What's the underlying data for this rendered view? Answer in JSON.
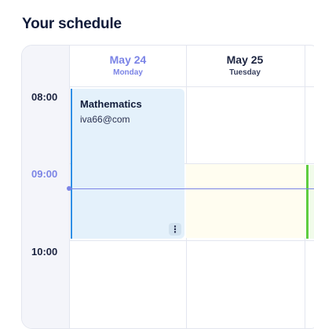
{
  "page": {
    "title": "Your schedule"
  },
  "calendar": {
    "days": [
      {
        "date": "May 24",
        "weekday": "Monday",
        "active": true
      },
      {
        "date": "May 25",
        "weekday": "Tuesday",
        "active": false
      }
    ],
    "times": [
      "08:00",
      "09:00",
      "10:00"
    ],
    "current_time_label": "09:00",
    "events": [
      {
        "title": "Mathematics",
        "subtitle": "iva66@com",
        "menu_icon": "vertical-dots-icon"
      }
    ]
  },
  "colors": {
    "accent": "#7b84e6",
    "event_bg": "#e4f1fb",
    "event_border": "#2f8fe6",
    "available_green": "#5fcc3f"
  }
}
